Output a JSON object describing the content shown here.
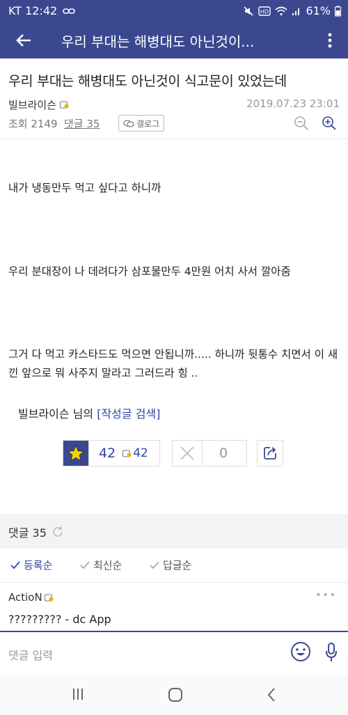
{
  "status_bar": {
    "carrier_time": "KT 12:42",
    "battery": "61%"
  },
  "appbar": {
    "title": "우리 부대는 해병대도 아닌것이..."
  },
  "post": {
    "title": "우리 부대는 해병대도 아닌것이 식고문이 있었는데",
    "author": "빌브라이슨",
    "date": "2019.07.23 23:01",
    "views": "조회 2149",
    "comments_link": "댓글 35",
    "gallery_button": "갤로그",
    "paragraphs": [
      "내가 냉동만두 먹고 싶다고 하니까",
      "우리 분대장이 나 데려다가 삼포물만두 4만원 어치 사서 깔아줌",
      "그거 다 먹고 카스타드도 먹으면 안됩니까..... 하니까 뒷통수 치면서 이 새낀 앞으로 뭐 사주지 말라고 그러드라 힝 .."
    ],
    "author_search": {
      "prefix": "빌브라이슨 님의 ",
      "link": "[작성글 검색]"
    }
  },
  "votes": {
    "recommend": "42",
    "fixed_recommend": "42",
    "unrecommend": "0"
  },
  "comments": {
    "header": "댓글 35",
    "sort_options": [
      "등록순",
      "최신순",
      "답글순"
    ],
    "items": [
      {
        "nick": "ActioN",
        "body": "????????? - dc App"
      }
    ],
    "input_placeholder": "댓글 입력"
  },
  "colors": {
    "brand": "#3b4890",
    "link": "#2e45a8",
    "star": "#f5d20a"
  }
}
